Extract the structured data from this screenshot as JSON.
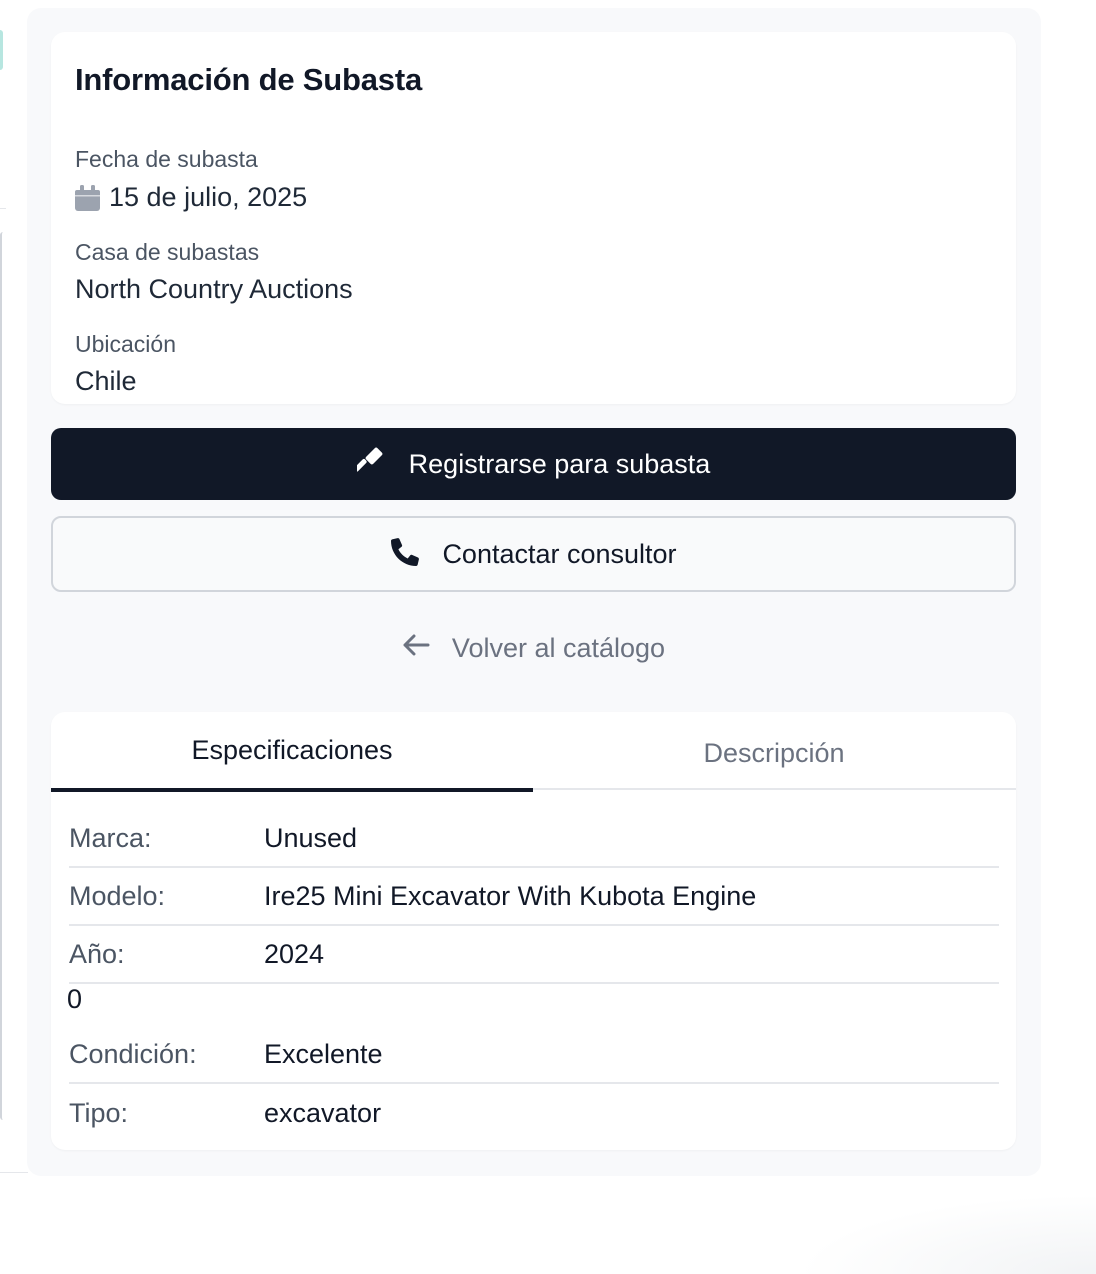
{
  "auction_info": {
    "title": "Información de Subasta",
    "date_label": "Fecha de subasta",
    "date_value": "15 de julio, 2025",
    "house_label": "Casa de subastas",
    "house_value": "North Country Auctions",
    "location_label": "Ubicación",
    "location_value": "Chile"
  },
  "actions": {
    "register_label": "Registrarse para subasta",
    "contact_label": "Contactar consultor",
    "back_label": "Volver al catálogo"
  },
  "tabs": [
    {
      "label": "Especificaciones",
      "active": true
    },
    {
      "label": "Descripción",
      "active": false
    }
  ],
  "specs": [
    {
      "key": "Marca:",
      "value": "Unused"
    },
    {
      "key": "Modelo:",
      "value": "Ire25 Mini Excavator With Kubota Engine"
    },
    {
      "key": "Año:",
      "value": "2024"
    },
    {
      "key": "Condición:",
      "value": "Excelente"
    },
    {
      "key": "Tipo:",
      "value": "excavator"
    }
  ],
  "stray_value": "0",
  "colors": {
    "primary": "#111827",
    "muted": "#6b7280",
    "panel_bg": "#f8f9fb",
    "border": "#e5e7eb"
  },
  "icons": {
    "calendar": "calendar-icon",
    "gavel": "gavel-icon",
    "phone": "phone-icon",
    "back": "arrow-left-icon"
  }
}
